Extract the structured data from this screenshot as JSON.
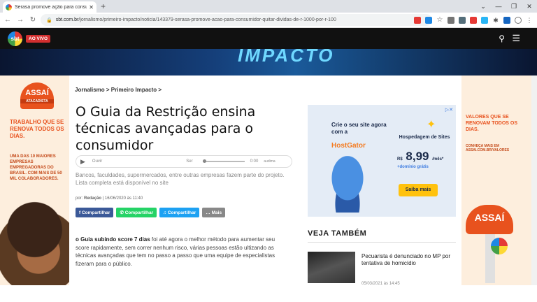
{
  "browser": {
    "tab_title": "Serasa promove ação para consu",
    "tab_close": "✕",
    "new_tab": "+",
    "url_host": "sbt.com.br",
    "url_path": "/jornalismo/primeiro-impacto/noticia/143379-serasa-promove-acao-para-consumidor-quitar-dividas-de-r-1000-por-r-100"
  },
  "site": {
    "logo": "sbt",
    "live_label": "AO VIVO",
    "banner_word": "IMPACTO"
  },
  "article": {
    "breadcrumb": "Jornalismo > Primeiro Impacto >",
    "title": "O Guia da Restrição ensina técnicas avançadas para o consumidor",
    "audio": {
      "listen": "Ouvir",
      "voice": "Ser",
      "time": "0:00",
      "brand": "audima"
    },
    "lede": "Bancos, faculdades, supermercados, entre outras empresas fazem parte do projeto. Lista completa está disponível no site",
    "byline_prefix": "por:",
    "byline_author": "Redação",
    "byline_date": "| 16/06/2020 às 11:40",
    "share": {
      "facebook": "Compartilhar",
      "whatsapp": "Compartilhar",
      "twitter": "Compartilhar",
      "more": "Mais"
    },
    "body_bold": "o Guia subindo score 7 dias",
    "body_rest": " foi até agora o melhor método para aumentar seu score rapidamente, sem correr nenhum risco, várias pessoas estão ultizando as técnicas avançadas que tem no passo a passo que uma equipe de especialistas fizeram para o público."
  },
  "ads": {
    "left": {
      "logo": "ASSAÍ",
      "logo_sub": "ATACADISTA",
      "slogan": "TRABALHO QUE SE RENOVA TODOS OS DIAS.",
      "info": "UMA DAS 10 MAIORES EMPRESAS EMPREGADORAS DO BRASIL. COM MAIS DE 50 MIL COLABORADORES."
    },
    "right": {
      "slogan": "VALORES QUE SE RENOVAM TODOS OS DIAS.",
      "info": "CONHEÇA MAIS EM ASSAI.COM.BR/VALORES",
      "sign": "ASSAÍ"
    },
    "hostgator": {
      "headline": "Crie o seu site agora com a",
      "brand": "HostGator",
      "product": "Hospedagem de Sites",
      "currency": "R$",
      "price": "8,99",
      "period": "/mês*",
      "domain": "+domínio grátis",
      "cta": "Saiba mais"
    }
  },
  "see_also": {
    "heading": "VEJA TAMBÉM",
    "items": [
      {
        "title": "Pecuarista é denunciado no MP por tentativa de homicídio",
        "date": "05/03/2021 às 14:45"
      }
    ]
  }
}
